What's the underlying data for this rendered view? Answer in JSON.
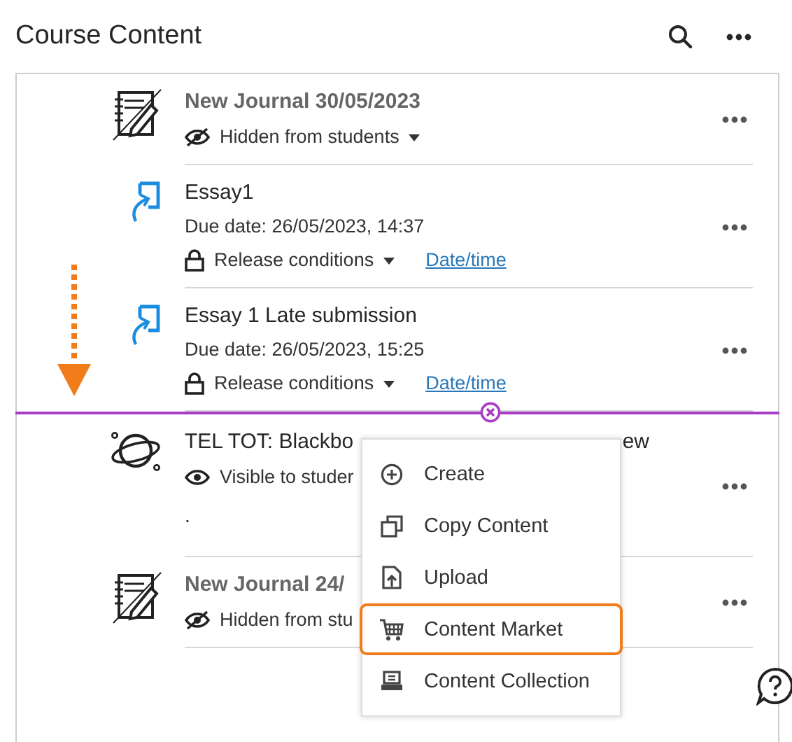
{
  "header": {
    "title": "Course Content"
  },
  "items": [
    {
      "kind": "journal",
      "title": "New Journal 30/05/2023",
      "muted": true,
      "status": {
        "kind": "hidden",
        "label": "Hidden from students",
        "caret": true
      }
    },
    {
      "kind": "assignment",
      "title": "Essay1",
      "muted": false,
      "due": "Due date: 26/05/2023, 14:37",
      "status": {
        "kind": "locked",
        "label": "Release conditions",
        "caret": true,
        "link": "Date/time"
      }
    },
    {
      "kind": "assignment",
      "title": "Essay 1 Late submission",
      "muted": false,
      "due": "Due date: 26/05/2023, 15:25",
      "status": {
        "kind": "locked",
        "label": "Release conditions",
        "caret": true,
        "link": "Date/time"
      }
    },
    {
      "kind": "module",
      "title": "TEL TOT: Blackbo",
      "title_end": "ew",
      "muted": false,
      "status": {
        "kind": "visible",
        "label": "Visible to studer",
        "caret": false
      },
      "description": "."
    },
    {
      "kind": "journal",
      "title": "New Journal 24/",
      "muted": true,
      "status": {
        "kind": "hidden",
        "label": "Hidden from stu",
        "caret": false
      }
    }
  ],
  "menu": [
    {
      "label": "Create",
      "highlighted": false
    },
    {
      "label": "Copy Content",
      "highlighted": false
    },
    {
      "label": "Upload",
      "highlighted": false
    },
    {
      "label": "Content Market",
      "highlighted": true
    },
    {
      "label": "Content Collection",
      "highlighted": false
    }
  ]
}
